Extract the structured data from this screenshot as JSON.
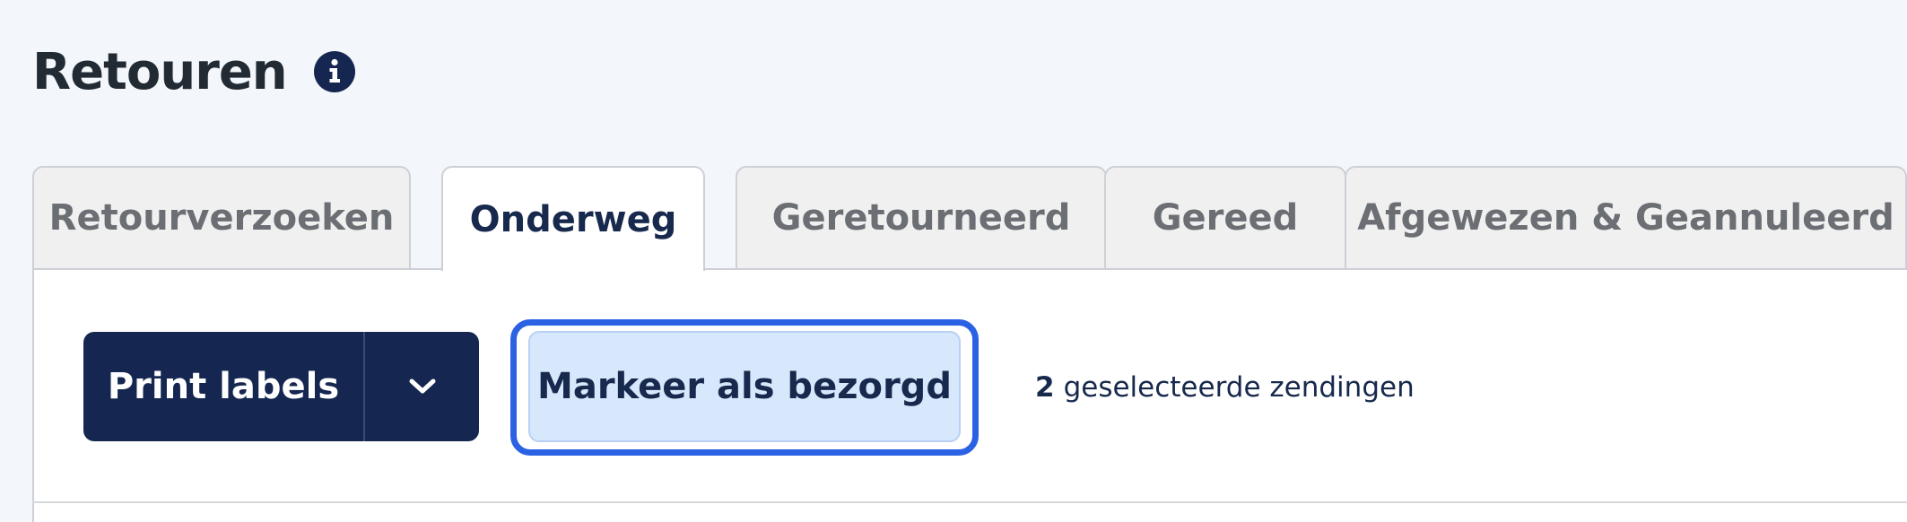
{
  "header": {
    "title": "Retouren",
    "info_icon": "info-icon"
  },
  "tabs": [
    {
      "label": "Retourverzoeken",
      "active": false
    },
    {
      "label": "Onderweg",
      "active": true
    },
    {
      "label": "Geretourneerd",
      "active": false
    },
    {
      "label": "Gereed",
      "active": false
    },
    {
      "label": "Afgewezen & Geannuleerd",
      "active": false
    }
  ],
  "toolbar": {
    "print_labels": "Print labels",
    "print_dropdown_icon": "chevron-down-icon",
    "mark_delivered": "Markeer als bezorgd",
    "selected_count": "2",
    "selected_text": "geselecteerde zendingen"
  },
  "colors": {
    "background": "#f3f7fc",
    "primary_navy": "#152750",
    "active_tab_text": "#17294d",
    "inactive_tab_text": "#6b6e73",
    "inactive_tab_bg": "#f0f0f0",
    "secondary_button_bg": "#d8e8fc",
    "focus_ring": "#2b62e3"
  }
}
